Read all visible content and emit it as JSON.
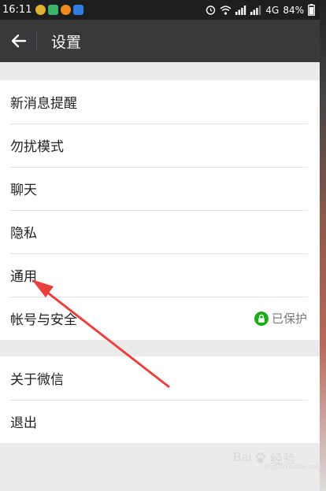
{
  "status_bar": {
    "time": "16:11",
    "network": "4G",
    "battery": "84%"
  },
  "toolbar": {
    "title": "设置"
  },
  "settings": {
    "items": [
      {
        "label": "新消息提醒"
      },
      {
        "label": "勿扰模式"
      },
      {
        "label": "聊天"
      },
      {
        "label": "隐私"
      },
      {
        "label": "通用"
      },
      {
        "label": "帐号与安全",
        "status": "已保护"
      }
    ],
    "items2": [
      {
        "label": "关于微信"
      },
      {
        "label": "退出"
      }
    ]
  },
  "watermark": {
    "text": "Bai",
    "text2": "经验",
    "sub": "jingyan.baidu.com"
  },
  "colors": {
    "toolbar": "#37393b",
    "statusbar": "#1d1e20",
    "background": "#ebebeb",
    "lock_green": "#1aad19",
    "arrow": "#e8413c"
  }
}
